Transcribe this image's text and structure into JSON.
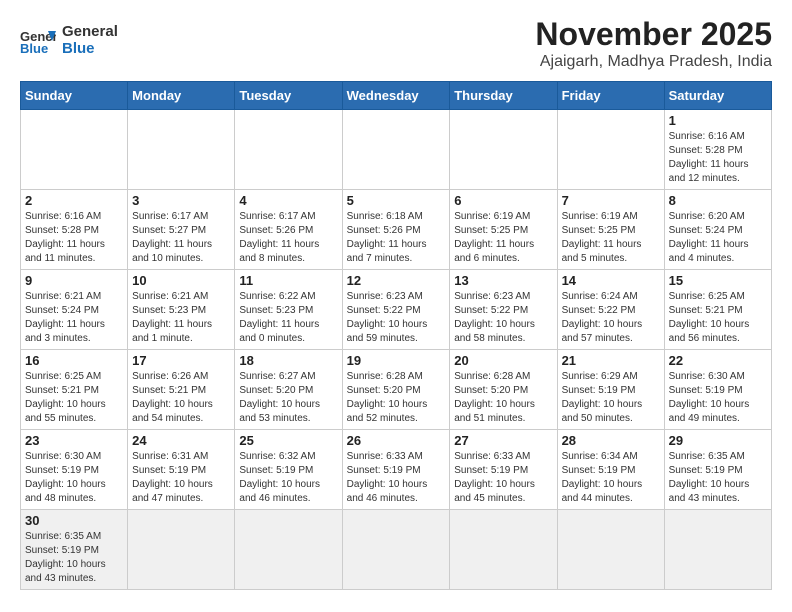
{
  "header": {
    "logo_general": "General",
    "logo_blue": "Blue",
    "month": "November 2025",
    "location": "Ajaigarh, Madhya Pradesh, India"
  },
  "weekdays": [
    "Sunday",
    "Monday",
    "Tuesday",
    "Wednesday",
    "Thursday",
    "Friday",
    "Saturday"
  ],
  "weeks": [
    [
      {
        "day": "",
        "info": ""
      },
      {
        "day": "",
        "info": ""
      },
      {
        "day": "",
        "info": ""
      },
      {
        "day": "",
        "info": ""
      },
      {
        "day": "",
        "info": ""
      },
      {
        "day": "",
        "info": ""
      },
      {
        "day": "1",
        "info": "Sunrise: 6:16 AM\nSunset: 5:28 PM\nDaylight: 11 hours and 12 minutes."
      }
    ],
    [
      {
        "day": "2",
        "info": "Sunrise: 6:16 AM\nSunset: 5:28 PM\nDaylight: 11 hours and 11 minutes."
      },
      {
        "day": "3",
        "info": "Sunrise: 6:17 AM\nSunset: 5:27 PM\nDaylight: 11 hours and 10 minutes."
      },
      {
        "day": "4",
        "info": "Sunrise: 6:17 AM\nSunset: 5:26 PM\nDaylight: 11 hours and 8 minutes."
      },
      {
        "day": "5",
        "info": "Sunrise: 6:18 AM\nSunset: 5:26 PM\nDaylight: 11 hours and 7 minutes."
      },
      {
        "day": "6",
        "info": "Sunrise: 6:19 AM\nSunset: 5:25 PM\nDaylight: 11 hours and 6 minutes."
      },
      {
        "day": "7",
        "info": "Sunrise: 6:19 AM\nSunset: 5:25 PM\nDaylight: 11 hours and 5 minutes."
      },
      {
        "day": "8",
        "info": "Sunrise: 6:20 AM\nSunset: 5:24 PM\nDaylight: 11 hours and 4 minutes."
      }
    ],
    [
      {
        "day": "9",
        "info": "Sunrise: 6:21 AM\nSunset: 5:24 PM\nDaylight: 11 hours and 3 minutes."
      },
      {
        "day": "10",
        "info": "Sunrise: 6:21 AM\nSunset: 5:23 PM\nDaylight: 11 hours and 1 minute."
      },
      {
        "day": "11",
        "info": "Sunrise: 6:22 AM\nSunset: 5:23 PM\nDaylight: 11 hours and 0 minutes."
      },
      {
        "day": "12",
        "info": "Sunrise: 6:23 AM\nSunset: 5:22 PM\nDaylight: 10 hours and 59 minutes."
      },
      {
        "day": "13",
        "info": "Sunrise: 6:23 AM\nSunset: 5:22 PM\nDaylight: 10 hours and 58 minutes."
      },
      {
        "day": "14",
        "info": "Sunrise: 6:24 AM\nSunset: 5:22 PM\nDaylight: 10 hours and 57 minutes."
      },
      {
        "day": "15",
        "info": "Sunrise: 6:25 AM\nSunset: 5:21 PM\nDaylight: 10 hours and 56 minutes."
      }
    ],
    [
      {
        "day": "16",
        "info": "Sunrise: 6:25 AM\nSunset: 5:21 PM\nDaylight: 10 hours and 55 minutes."
      },
      {
        "day": "17",
        "info": "Sunrise: 6:26 AM\nSunset: 5:21 PM\nDaylight: 10 hours and 54 minutes."
      },
      {
        "day": "18",
        "info": "Sunrise: 6:27 AM\nSunset: 5:20 PM\nDaylight: 10 hours and 53 minutes."
      },
      {
        "day": "19",
        "info": "Sunrise: 6:28 AM\nSunset: 5:20 PM\nDaylight: 10 hours and 52 minutes."
      },
      {
        "day": "20",
        "info": "Sunrise: 6:28 AM\nSunset: 5:20 PM\nDaylight: 10 hours and 51 minutes."
      },
      {
        "day": "21",
        "info": "Sunrise: 6:29 AM\nSunset: 5:19 PM\nDaylight: 10 hours and 50 minutes."
      },
      {
        "day": "22",
        "info": "Sunrise: 6:30 AM\nSunset: 5:19 PM\nDaylight: 10 hours and 49 minutes."
      }
    ],
    [
      {
        "day": "23",
        "info": "Sunrise: 6:30 AM\nSunset: 5:19 PM\nDaylight: 10 hours and 48 minutes."
      },
      {
        "day": "24",
        "info": "Sunrise: 6:31 AM\nSunset: 5:19 PM\nDaylight: 10 hours and 47 minutes."
      },
      {
        "day": "25",
        "info": "Sunrise: 6:32 AM\nSunset: 5:19 PM\nDaylight: 10 hours and 46 minutes."
      },
      {
        "day": "26",
        "info": "Sunrise: 6:33 AM\nSunset: 5:19 PM\nDaylight: 10 hours and 46 minutes."
      },
      {
        "day": "27",
        "info": "Sunrise: 6:33 AM\nSunset: 5:19 PM\nDaylight: 10 hours and 45 minutes."
      },
      {
        "day": "28",
        "info": "Sunrise: 6:34 AM\nSunset: 5:19 PM\nDaylight: 10 hours and 44 minutes."
      },
      {
        "day": "29",
        "info": "Sunrise: 6:35 AM\nSunset: 5:19 PM\nDaylight: 10 hours and 43 minutes."
      }
    ],
    [
      {
        "day": "30",
        "info": "Sunrise: 6:35 AM\nSunset: 5:19 PM\nDaylight: 10 hours and 43 minutes."
      },
      {
        "day": "",
        "info": ""
      },
      {
        "day": "",
        "info": ""
      },
      {
        "day": "",
        "info": ""
      },
      {
        "day": "",
        "info": ""
      },
      {
        "day": "",
        "info": ""
      },
      {
        "day": "",
        "info": ""
      }
    ]
  ]
}
